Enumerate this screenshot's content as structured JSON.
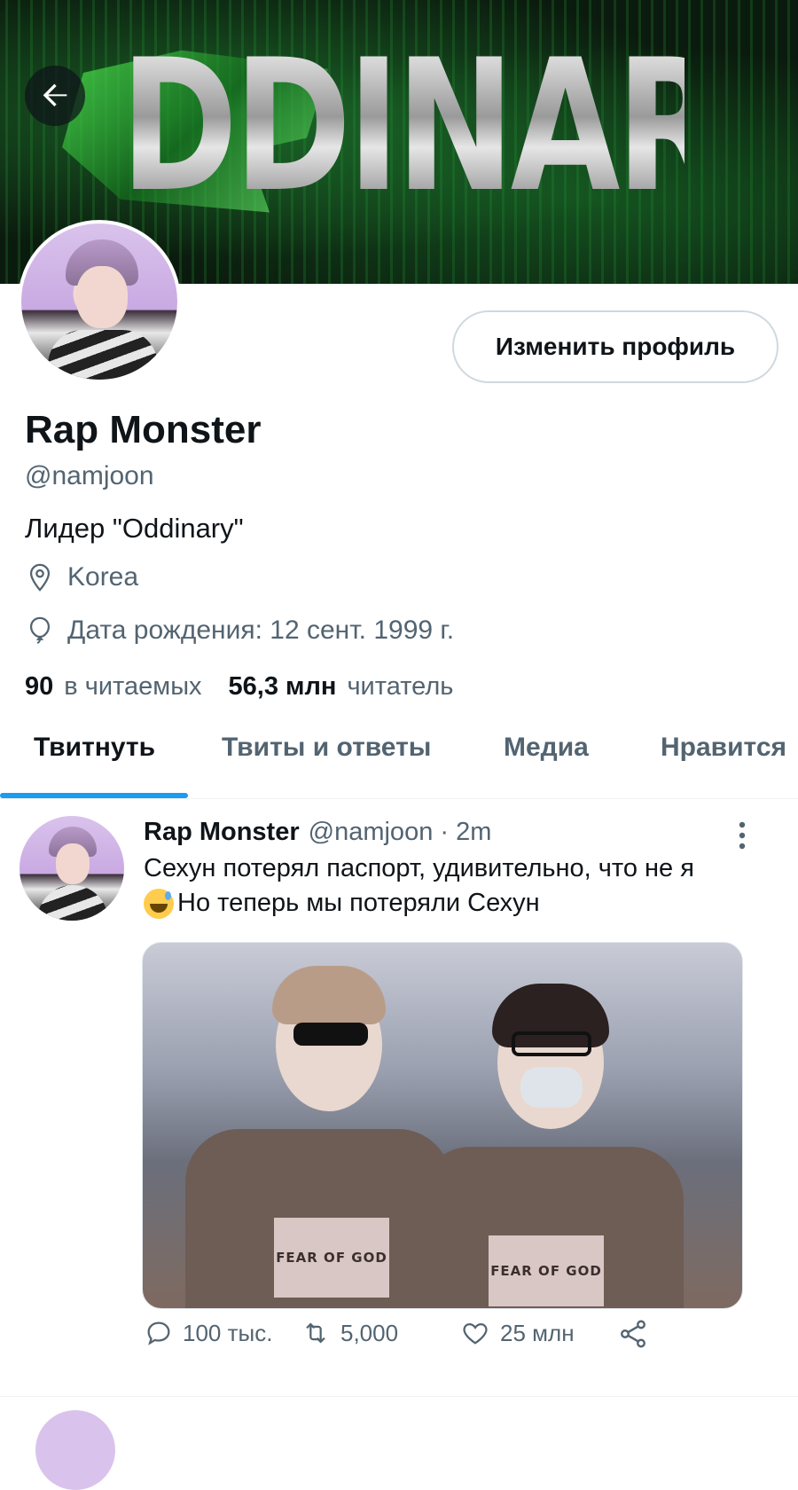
{
  "banner": {
    "word": "ODDINARY"
  },
  "profile": {
    "edit_button": "Изменить профиль",
    "name": "Rap Monster",
    "handle": "@namjoon",
    "bio": "Лидер \"Oddinary\"",
    "location": "Korea",
    "birthday": "Дата рождения: 12 сент. 1999 г.",
    "following_count": "90",
    "following_label": "в читаемых",
    "followers_count": "56,3 млн",
    "followers_label": "читатель"
  },
  "tabs": [
    {
      "label": "Твитнуть",
      "active": true
    },
    {
      "label": "Твиты и ответы",
      "active": false
    },
    {
      "label": "Медиа",
      "active": false
    },
    {
      "label": "Нравится",
      "active": false
    }
  ],
  "tweet": {
    "name": "Rap Monster",
    "handle_time": "@namjoon · 2m",
    "text_line1": "Сехун потерял паспорт, удивительно, что не я",
    "text_line2": "Но теперь мы потеряли Сехун",
    "image_print": "FEAR OF GOD",
    "replies": "100 тыс.",
    "retweets": "5,000",
    "likes": "25 млн"
  },
  "icons": {
    "back": "arrow-left-icon",
    "location": "location-pin-icon",
    "birthday": "balloon-icon",
    "more": "more-vertical-icon",
    "reply": "reply-icon",
    "retweet": "retweet-icon",
    "like": "heart-icon",
    "share": "share-icon"
  },
  "colors": {
    "accent": "#1d9bf0",
    "secondary_text": "#536471",
    "primary_text": "#0f1419"
  }
}
